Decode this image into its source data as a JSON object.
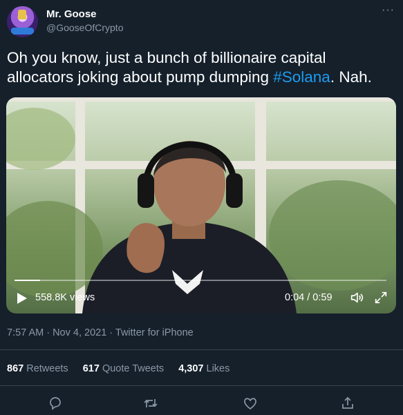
{
  "author": {
    "name": "Mr. Goose",
    "handle": "@GooseOfCrypto"
  },
  "tweet": {
    "text_before": "Oh you know, just a bunch of billionaire capital allocators joking about pump dumping ",
    "hashtag": "#Solana",
    "text_after": ". Nah."
  },
  "video": {
    "views": "558.8K views",
    "time": "0:04 / 0:59",
    "progress": 0.068
  },
  "meta": {
    "time": "7:57 AM",
    "date": "Nov 4, 2021",
    "source": "Twitter for iPhone",
    "line": "7:57 AM · Nov 4, 2021 · Twitter for iPhone"
  },
  "stats": {
    "retweets_count": "867",
    "retweets_label": "Retweets",
    "quotes_count": "617",
    "quotes_label": "Quote Tweets",
    "likes_count": "4,307",
    "likes_label": "Likes"
  },
  "icons": {
    "more": "more-icon",
    "reply": "reply-icon",
    "retweet": "retweet-icon",
    "like": "like-icon",
    "share": "share-icon"
  },
  "colors": {
    "background": "#15202b",
    "accent": "#1d9bf0",
    "secondary_text": "#8b98a5",
    "divider": "#38444d"
  }
}
